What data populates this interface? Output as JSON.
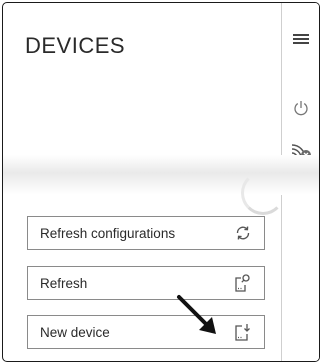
{
  "header": {
    "title": "DEVICES"
  },
  "rail": {
    "menu_icon": "hamburger-menu-icon",
    "power_icon": "power-icon",
    "cast_icon": "cast-disconnected-icon"
  },
  "actions": [
    {
      "label": "Refresh configurations",
      "icon": "sync-icon"
    },
    {
      "label": "Refresh",
      "icon": "device-search-icon"
    },
    {
      "label": "New device",
      "icon": "device-download-icon"
    }
  ]
}
